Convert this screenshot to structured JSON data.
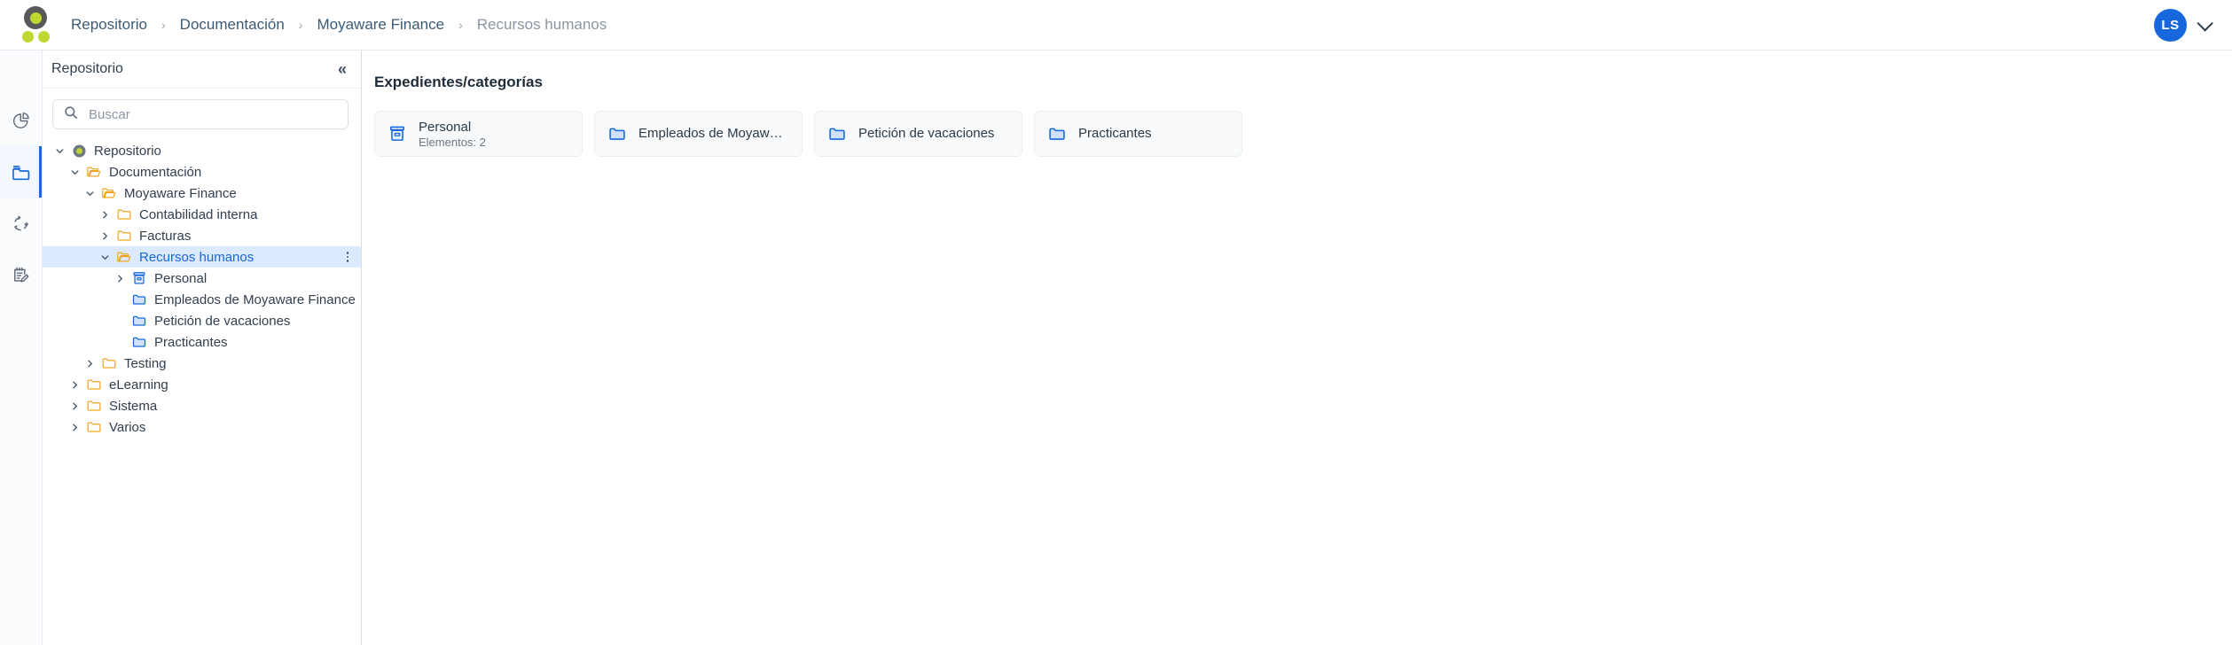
{
  "brand": {
    "logo_icon": "moyaware-logo-icon",
    "accent_green": "#bfd730",
    "logo_gray": "#58595b",
    "accent_blue": "#1668dc",
    "folder_orange": "#f0a41e",
    "folder_blue": "#1668dc"
  },
  "breadcrumb": {
    "items": [
      {
        "label": "Repositorio",
        "current": false
      },
      {
        "label": "Documentación",
        "current": false
      },
      {
        "label": "Moyaware Finance",
        "current": false
      },
      {
        "label": "Recursos humanos",
        "current": true
      }
    ],
    "separator": "›"
  },
  "user": {
    "initials": "LS",
    "avatar_icon": "avatar",
    "menu_icon": "chevron-down-icon"
  },
  "rail": {
    "items": [
      {
        "icon": "pie-chart-icon",
        "name": "dashboard",
        "active": false
      },
      {
        "icon": "folder-icon",
        "name": "repository",
        "active": true
      },
      {
        "icon": "sync-arrows-icon",
        "name": "workflows",
        "active": false
      },
      {
        "icon": "notepad-pencil-icon",
        "name": "forms",
        "active": false
      }
    ]
  },
  "sidebar": {
    "title": "Repositorio",
    "collapse_icon": "collapse-left-icon",
    "collapse_label": "«",
    "search": {
      "placeholder": "Buscar",
      "value": "",
      "icon": "search-icon"
    },
    "tree": [
      {
        "label": "Repositorio",
        "depth": 0,
        "icon": "repository-root-icon",
        "twisty": "down",
        "selected": false,
        "kebab": false
      },
      {
        "label": "Documentación",
        "depth": 1,
        "icon": "folder-open-orange-icon",
        "twisty": "down",
        "selected": false,
        "kebab": false
      },
      {
        "label": "Moyaware Finance",
        "depth": 2,
        "icon": "folder-open-orange-icon",
        "twisty": "down",
        "selected": false,
        "kebab": false
      },
      {
        "label": "Contabilidad interna",
        "depth": 3,
        "icon": "folder-closed-orange-icon",
        "twisty": "right",
        "selected": false,
        "kebab": false
      },
      {
        "label": "Facturas",
        "depth": 3,
        "icon": "folder-closed-orange-icon",
        "twisty": "right",
        "selected": false,
        "kebab": false
      },
      {
        "label": "Recursos humanos",
        "depth": 3,
        "icon": "folder-open-orange-icon",
        "twisty": "down",
        "selected": true,
        "kebab": true
      },
      {
        "label": "Personal",
        "depth": 4,
        "icon": "archive-box-blue-icon",
        "twisty": "right",
        "selected": false,
        "kebab": false
      },
      {
        "label": "Empleados de Moyaware Finance",
        "depth": 4,
        "icon": "folder-blue-icon",
        "twisty": "none",
        "selected": false,
        "kebab": false
      },
      {
        "label": "Petición de vacaciones",
        "depth": 4,
        "icon": "folder-blue-icon",
        "twisty": "none",
        "selected": false,
        "kebab": false
      },
      {
        "label": "Practicantes",
        "depth": 4,
        "icon": "folder-blue-icon",
        "twisty": "none",
        "selected": false,
        "kebab": false
      },
      {
        "label": "Testing",
        "depth": 2,
        "icon": "folder-closed-orange-icon",
        "twisty": "right",
        "selected": false,
        "kebab": false
      },
      {
        "label": "eLearning",
        "depth": 1,
        "icon": "folder-closed-orange-icon",
        "twisty": "right",
        "selected": false,
        "kebab": false
      },
      {
        "label": "Sistema",
        "depth": 1,
        "icon": "folder-closed-orange-icon",
        "twisty": "right",
        "selected": false,
        "kebab": false
      },
      {
        "label": "Varios",
        "depth": 1,
        "icon": "folder-closed-orange-icon",
        "twisty": "right",
        "selected": false,
        "kebab": false
      }
    ]
  },
  "main": {
    "title": "Expedientes/categorías",
    "cards": [
      {
        "name": "Personal",
        "sub": "Elementos: 2",
        "icon": "archive-box-blue-icon"
      },
      {
        "name": "Empleados de Moyaware F...",
        "sub": "",
        "icon": "folder-blue-icon"
      },
      {
        "name": "Petición de vacaciones",
        "sub": "",
        "icon": "folder-blue-icon"
      },
      {
        "name": "Practicantes",
        "sub": "",
        "icon": "folder-blue-icon"
      }
    ]
  }
}
